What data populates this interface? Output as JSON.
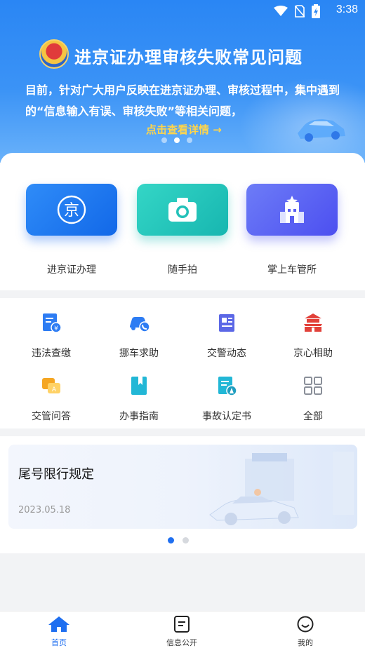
{
  "status_bar": {
    "time": "3:38"
  },
  "banner": {
    "title": "进京证办理审核失败常见问题",
    "description": "目前，针对广大用户反映在进京证办理、审核过程中，集中遇到的“信息输入有误、审核失败”等相关问题，",
    "link": "点击查看详情 →",
    "slides": 3,
    "active_slide": 1
  },
  "main_services": [
    {
      "label": "进京证办理",
      "icon": "jing-badge-icon"
    },
    {
      "label": "随手拍",
      "icon": "camera-icon"
    },
    {
      "label": "掌上车管所",
      "icon": "building-star-icon"
    }
  ],
  "services": [
    {
      "label": "违法查缴",
      "icon": "fine-payment-icon"
    },
    {
      "label": "挪车求助",
      "icon": "move-car-call-icon"
    },
    {
      "label": "交警动态",
      "icon": "news-icon"
    },
    {
      "label": "京心相助",
      "icon": "tiananmen-icon"
    },
    {
      "label": "交管问答",
      "icon": "qa-chat-icon"
    },
    {
      "label": "办事指南",
      "icon": "guide-book-icon"
    },
    {
      "label": "事故认定书",
      "icon": "accident-document-icon"
    },
    {
      "label": "全部",
      "icon": "all-grid-icon"
    }
  ],
  "notice": {
    "title": "尾号限行规定",
    "date": "2023.05.18",
    "slides": 2,
    "active_slide": 0
  },
  "tabs": [
    {
      "label": "首页",
      "icon": "home-icon",
      "active": true
    },
    {
      "label": "信息公开",
      "icon": "document-icon",
      "active": false
    },
    {
      "label": "我的",
      "icon": "smile-icon",
      "active": false
    }
  ],
  "colors": {
    "primary": "#1f6ff0",
    "banner": "#2a86f4",
    "link": "#ffd54a"
  }
}
